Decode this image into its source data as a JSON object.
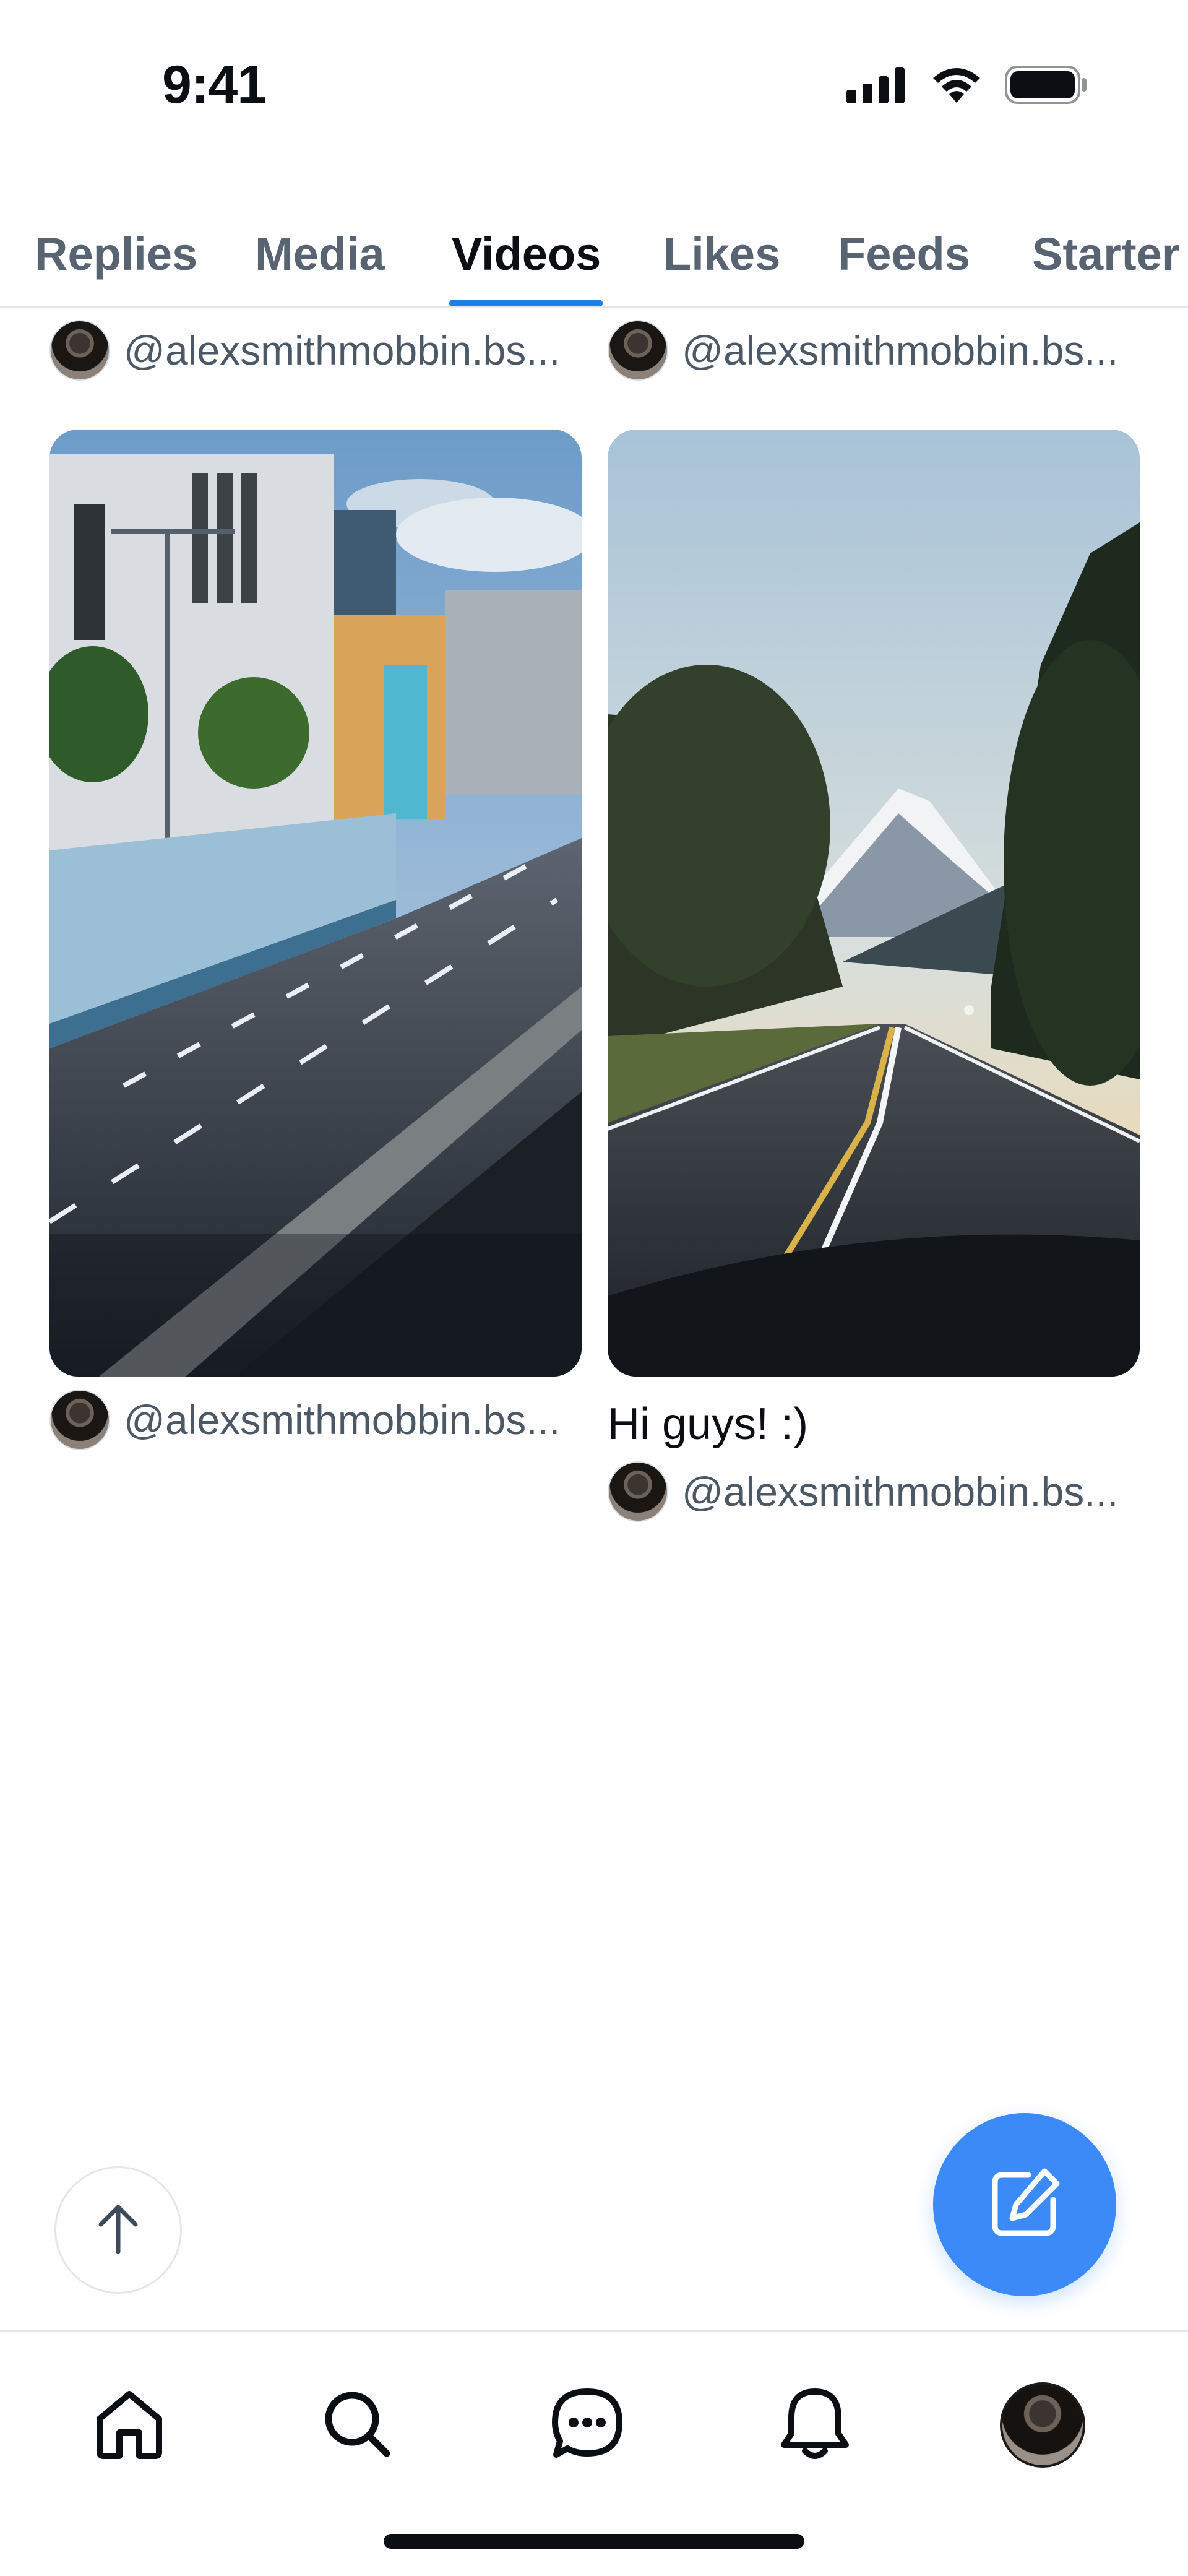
{
  "status_bar": {
    "time": "9:41",
    "icons": [
      "cellular-signal-icon",
      "wifi-icon",
      "battery-icon"
    ]
  },
  "tabs": [
    {
      "label": "Replies",
      "active": false
    },
    {
      "label": "Media",
      "active": false
    },
    {
      "label": "Videos",
      "active": true
    },
    {
      "label": "Likes",
      "active": false
    },
    {
      "label": "Feeds",
      "active": false
    },
    {
      "label": "Starter",
      "active": false
    }
  ],
  "feed": {
    "top_row_authors": [
      {
        "handle": "@alexsmithmobbin.bs..."
      },
      {
        "handle": "@alexsmithmobbin.bs..."
      }
    ],
    "posts": [
      {
        "thumbnail": "city-highway-video-thumbnail",
        "caption": "",
        "handle": "@alexsmithmobbin.bs..."
      },
      {
        "thumbnail": "mountain-road-video-thumbnail",
        "caption": "Hi guys! :)",
        "handle": "@alexsmithmobbin.bs..."
      }
    ]
  },
  "buttons": {
    "scroll_top_icon": "arrow-up-icon",
    "compose_icon": "compose-icon"
  },
  "bottom_nav": [
    {
      "icon": "home-icon"
    },
    {
      "icon": "search-icon"
    },
    {
      "icon": "chat-icon"
    },
    {
      "icon": "bell-icon"
    },
    {
      "icon": "profile-avatar"
    }
  ],
  "colors": {
    "accent": "#1d80e8",
    "fab": "#3c8af7",
    "text_primary": "#0b0f14",
    "text_secondary": "#4b5866"
  }
}
